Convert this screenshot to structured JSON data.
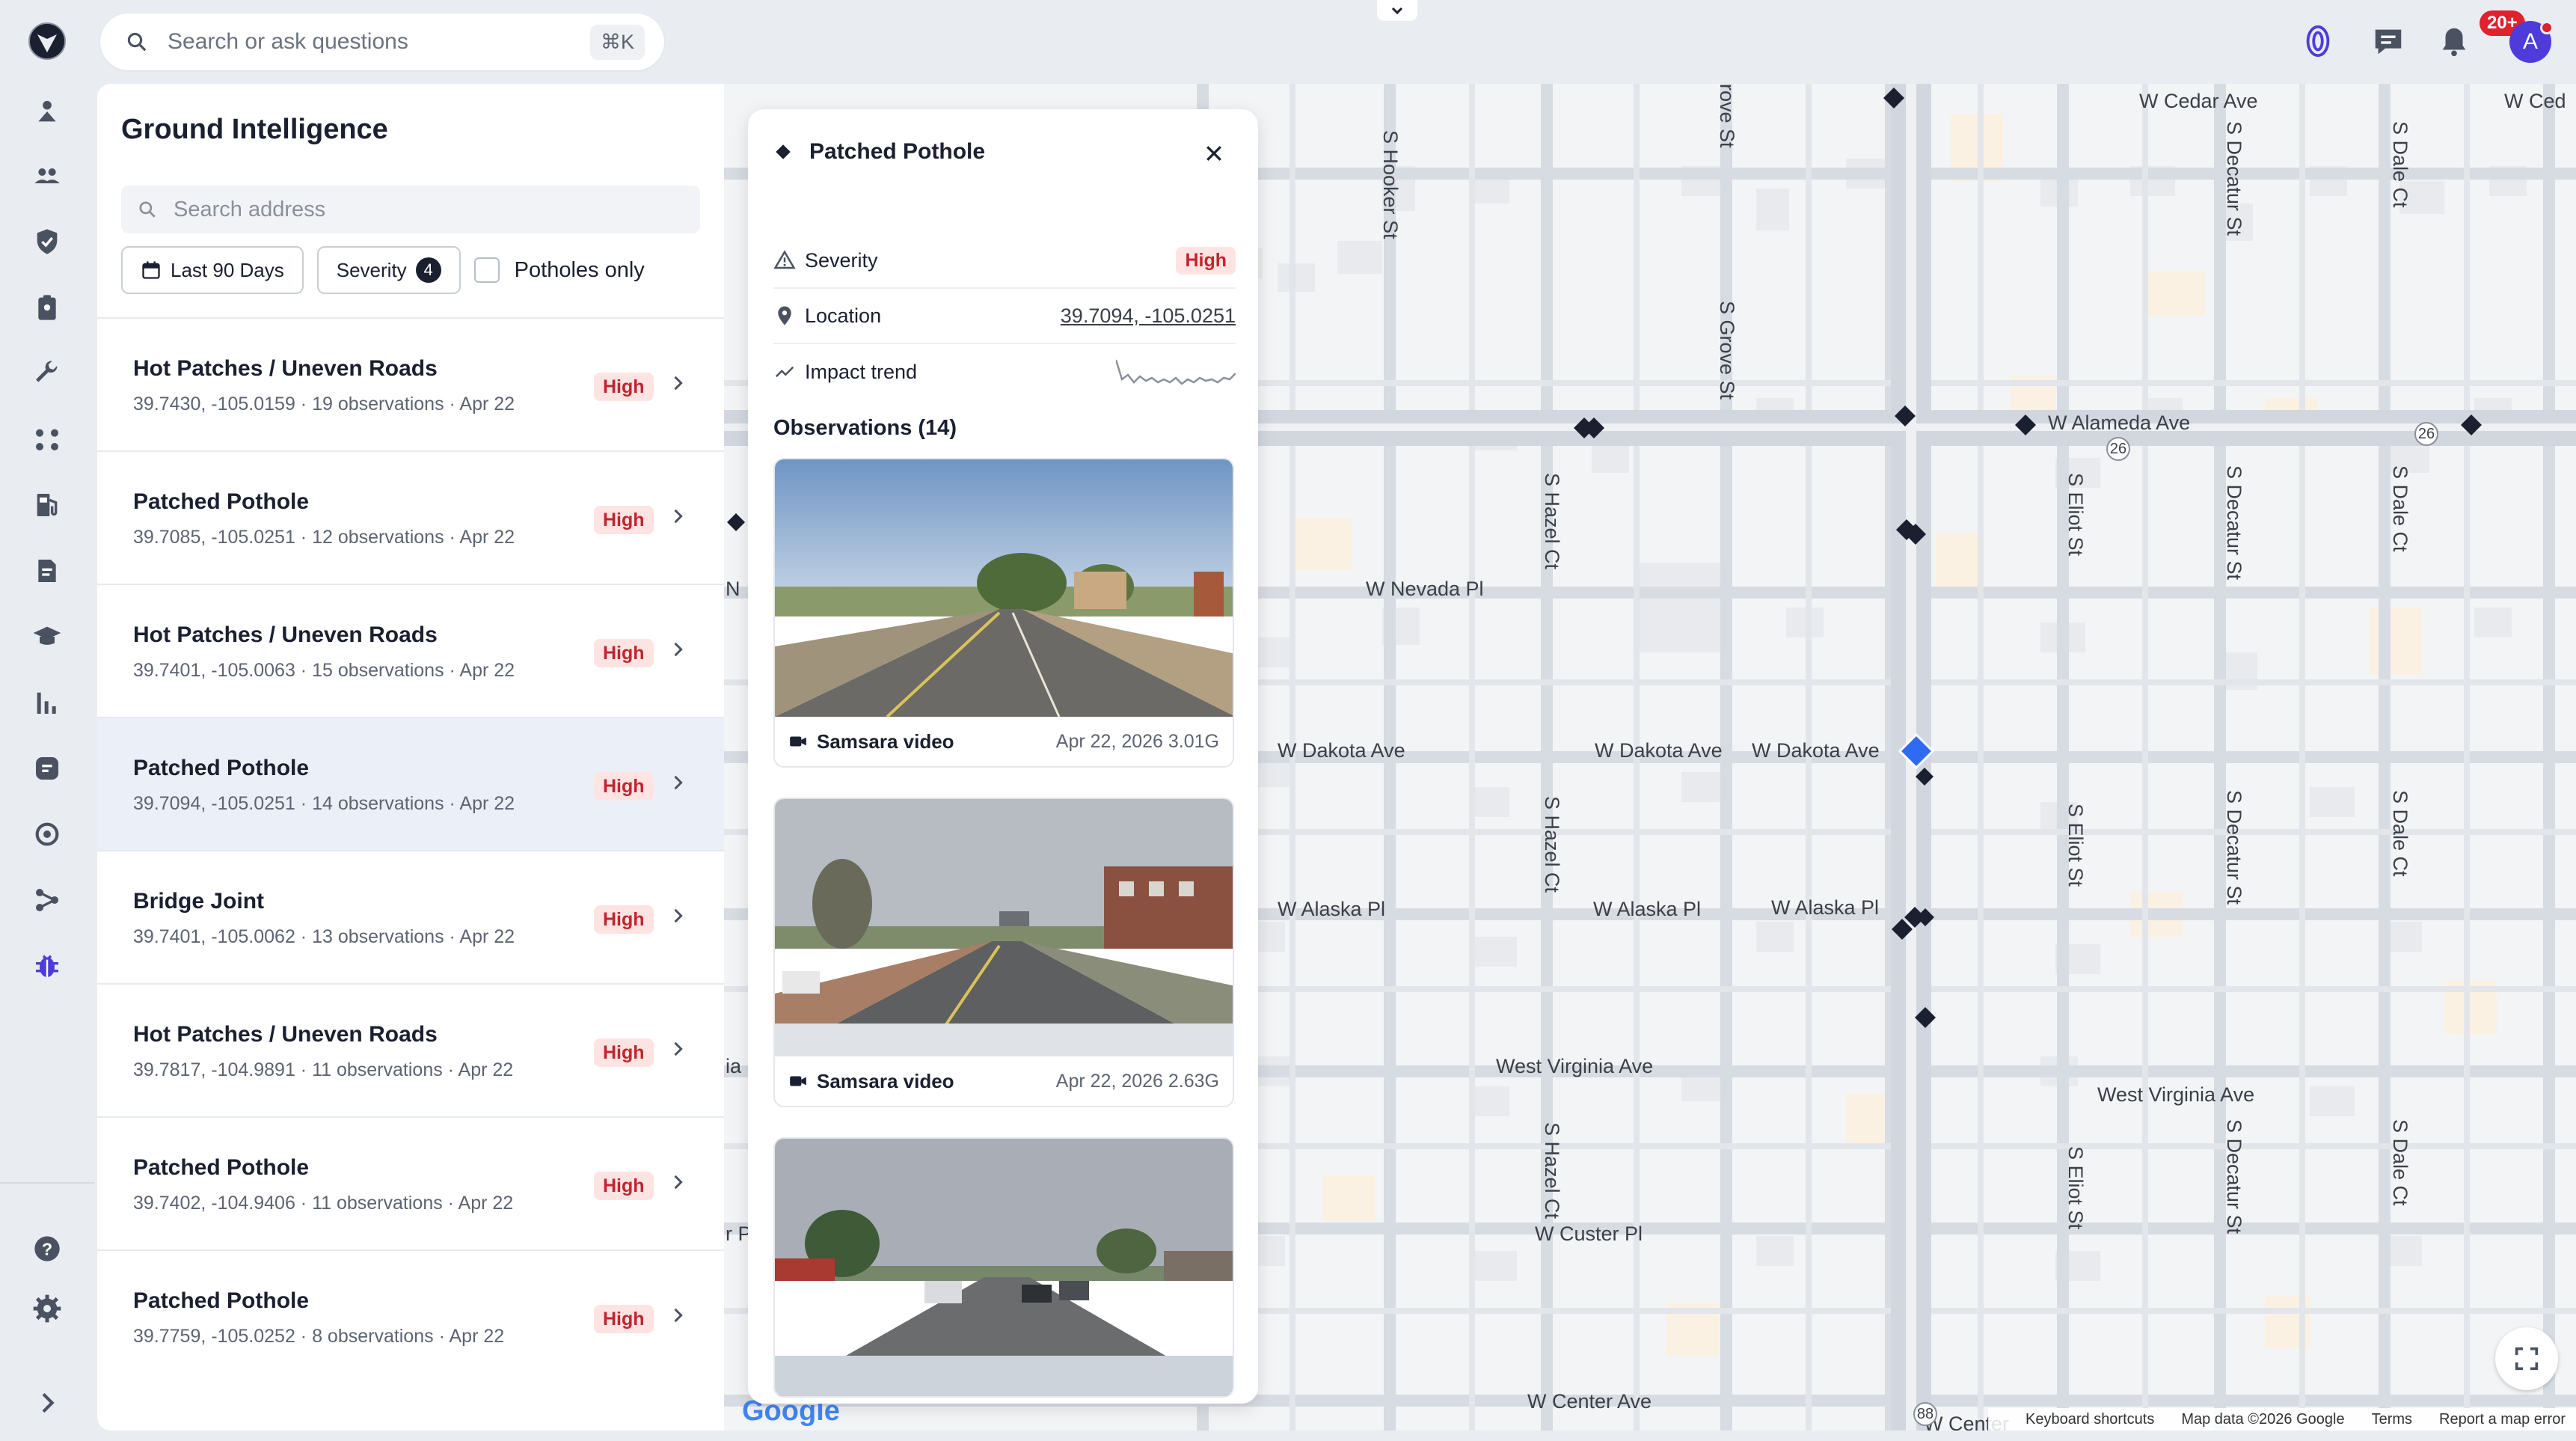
{
  "search": {
    "placeholder": "Search or ask questions",
    "shortcut": "⌘K"
  },
  "notifications": {
    "badge": "20+"
  },
  "user": {
    "initial": "A"
  },
  "rail": {
    "icons": [
      "map-pin-person-icon",
      "users-icon",
      "shield-check-icon",
      "clipboard-icon",
      "wrench-icon",
      "routes-icon",
      "fuel-icon",
      "document-icon",
      "academy-icon",
      "bar-chart-icon",
      "message-icon",
      "target-icon",
      "workflow-icon",
      "bug-icon",
      "help-icon",
      "settings-icon",
      "expand-chevron-icon"
    ]
  },
  "panel": {
    "title": "Ground Intelligence",
    "address_placeholder": "Search address",
    "filter_date": "Last 90 Days",
    "filter_severity": "Severity",
    "filter_severity_count": "4",
    "potholes_only": "Potholes only"
  },
  "results": [
    {
      "title": "Hot Patches / Uneven Roads",
      "meta": "39.7430, -105.0159 · 19 observations · Apr 22",
      "severity": "High"
    },
    {
      "title": "Patched Pothole",
      "meta": "39.7085, -105.0251 · 12 observations · Apr 22",
      "severity": "High"
    },
    {
      "title": "Hot Patches / Uneven Roads",
      "meta": "39.7401, -105.0063 · 15 observations · Apr 22",
      "severity": "High"
    },
    {
      "title": "Patched Pothole",
      "meta": "39.7094, -105.0251 · 14 observations · Apr 22",
      "severity": "High",
      "selected": true
    },
    {
      "title": "Bridge Joint",
      "meta": "39.7401, -105.0062 · 13 observations · Apr 22",
      "severity": "High"
    },
    {
      "title": "Hot Patches / Uneven Roads",
      "meta": "39.7817, -104.9891 · 11 observations · Apr 22",
      "severity": "High"
    },
    {
      "title": "Patched Pothole",
      "meta": "39.7402, -104.9406 · 11 observations · Apr 22",
      "severity": "High"
    },
    {
      "title": "Patched Pothole",
      "meta": "39.7759, -105.0252 · 8 observations · Apr 22",
      "severity": "High"
    }
  ],
  "detail": {
    "title": "Patched Pothole",
    "severity_label": "Severity",
    "severity_value": "High",
    "location_label": "Location",
    "location_value": "39.7094, -105.0251",
    "trend_label": "Impact trend",
    "observations_title": "Observations (14)",
    "observations": [
      {
        "source": "Samsara video",
        "when": "Apr 22, 2026 3.01G"
      },
      {
        "source": "Samsara video",
        "when": "Apr 22, 2026 2.63G"
      },
      {
        "source": "",
        "when": ""
      }
    ]
  },
  "map": {
    "streets": {
      "w_cedar_ave": "W Cedar Ave",
      "w_ced_edge": "W Ced",
      "s_hooker_st": "S Hooker St",
      "s_grove_st_top": "rove St",
      "s_grove_st": "S Grove St",
      "s_decatur_st": "S Decatur St",
      "s_dale_ct": "S Dale Ct",
      "w_alameda_ave": "W Alameda Ave",
      "s_hazel_ct": "S Hazel Ct",
      "s_eliot_st": "S Eliot St",
      "w_nevada_pl": "W Nevada Pl",
      "w_dakota_ave": "W Dakota Ave",
      "w_alaska_pl": "W Alaska Pl",
      "west_virginia_ave": "West Virginia Ave",
      "w_custer_pl": "W Custer Pl",
      "w_center_ave": "W Center Ave",
      "w_center_edge": "W Center",
      "edge_n": "N",
      "edge_ia": "ia",
      "edge_rp": "r P",
      "route_26": "26",
      "route_88": "88"
    },
    "footer": {
      "keyboard": "Keyboard shortcuts",
      "copyright": "Map data ©2026 Google",
      "terms": "Terms",
      "report": "Report a map error"
    },
    "logo": "Google"
  },
  "colors": {
    "accent": "#4f3bd9",
    "high": "#c0262e",
    "high_bg": "#fde4e3",
    "selected_row": "#ebf0f8",
    "marker": "#1b2030",
    "marker_active": "#2f6bf0"
  }
}
